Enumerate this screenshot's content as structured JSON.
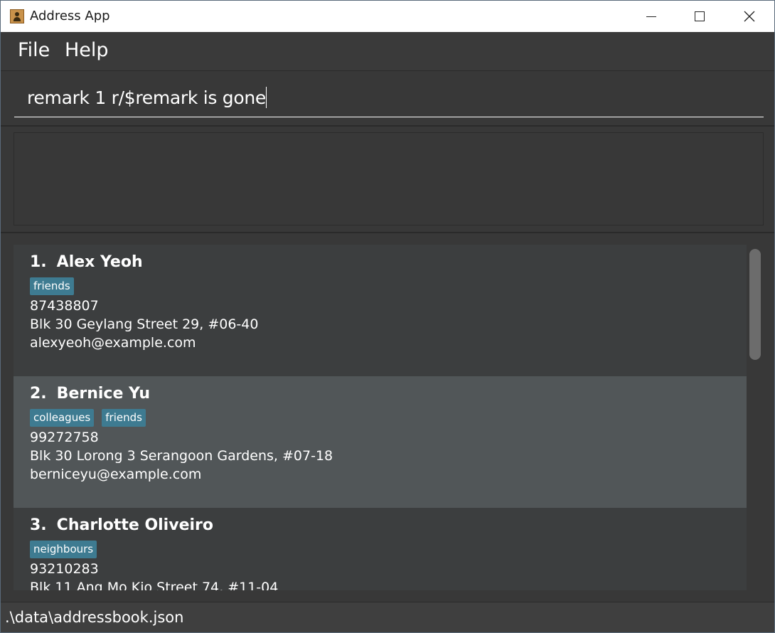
{
  "window": {
    "title": "Address App"
  },
  "menu": {
    "file_label": "File",
    "help_label": "Help"
  },
  "command": {
    "value": "remark 1 r/$remark is gone"
  },
  "result": {
    "text": ""
  },
  "persons": [
    {
      "index": "1.",
      "name": "Alex Yeoh",
      "tags": [
        "friends"
      ],
      "phone": "87438807",
      "address": "Blk 30 Geylang Street 29, #06-40",
      "email": "alexyeoh@example.com"
    },
    {
      "index": "2.",
      "name": "Bernice Yu",
      "tags": [
        "colleagues",
        "friends"
      ],
      "phone": "99272758",
      "address": "Blk 30 Lorong 3 Serangoon Gardens, #07-18",
      "email": "berniceyu@example.com"
    },
    {
      "index": "3.",
      "name": "Charlotte Oliveiro",
      "tags": [
        "neighbours"
      ],
      "phone": "93210283",
      "address": "Blk 11 Ang Mo Kio Street 74, #11-04",
      "email": ""
    }
  ],
  "status": {
    "file_path": ".\\data\\addressbook.json"
  },
  "colors": {
    "tag_bg": "#3e7b91",
    "card_odd": "#3c3e3f",
    "card_even": "#515658",
    "background": "#383838"
  }
}
